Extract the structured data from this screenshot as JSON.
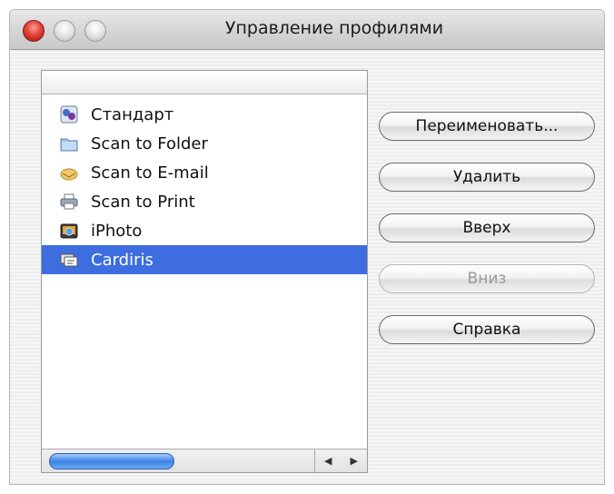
{
  "window": {
    "title": "Управление профилями"
  },
  "profiles": [
    {
      "label": "Стандарт",
      "icon": "standard-profile-icon",
      "selected": false
    },
    {
      "label": "Scan to Folder",
      "icon": "folder-profile-icon",
      "selected": false
    },
    {
      "label": "Scan to E-mail",
      "icon": "email-profile-icon",
      "selected": false
    },
    {
      "label": "Scan to Print",
      "icon": "printer-profile-icon",
      "selected": false
    },
    {
      "label": "iPhoto",
      "icon": "iphoto-icon",
      "selected": false
    },
    {
      "label": "Cardiris",
      "icon": "cardiris-icon",
      "selected": true
    }
  ],
  "buttons": {
    "rename": "Переименовать...",
    "delete": "Удалить",
    "up": "Вверх",
    "down": "Вниз",
    "help": "Справка"
  },
  "colors": {
    "selection": "#3d6dde",
    "close_button": "#e0433a"
  }
}
